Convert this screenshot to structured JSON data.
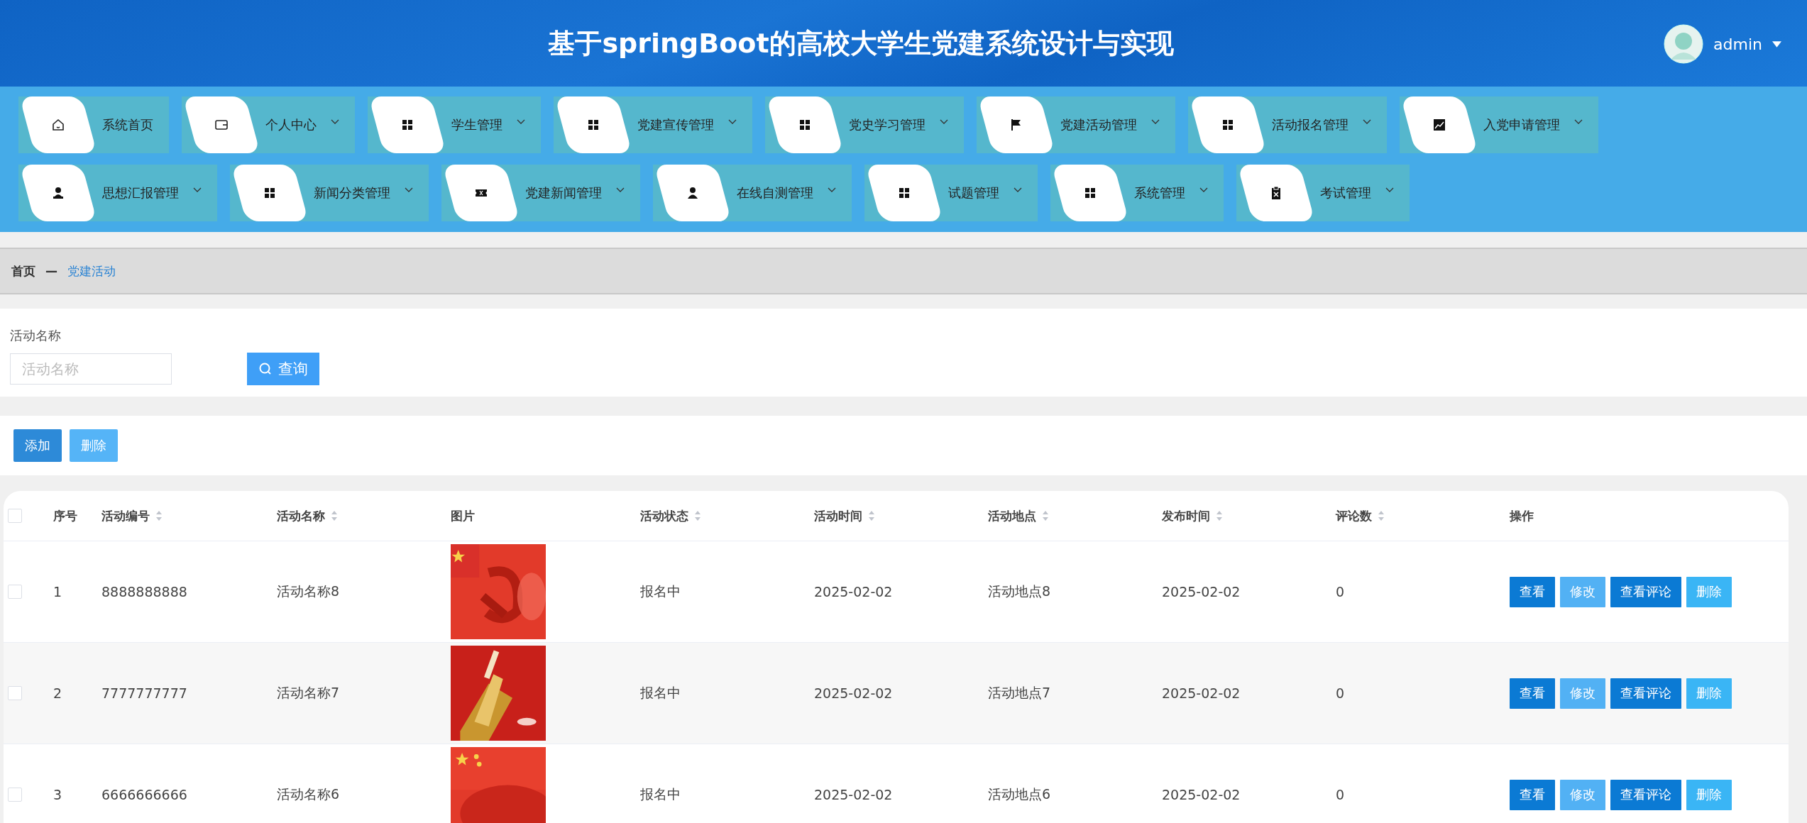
{
  "header": {
    "title": "基于springBoot的高校大学生党建系统设计与实现",
    "user": {
      "name": "admin"
    }
  },
  "nav": [
    {
      "label": "系统首页",
      "has_submenu": false
    },
    {
      "label": "个人中心",
      "has_submenu": true
    },
    {
      "label": "学生管理",
      "has_submenu": true
    },
    {
      "label": "党建宣传管理",
      "has_submenu": true
    },
    {
      "label": "党史学习管理",
      "has_submenu": true
    },
    {
      "label": "党建活动管理",
      "has_submenu": true
    },
    {
      "label": "活动报名管理",
      "has_submenu": true
    },
    {
      "label": "入党申请管理",
      "has_submenu": true
    },
    {
      "label": "思想汇报管理",
      "has_submenu": true
    },
    {
      "label": "新闻分类管理",
      "has_submenu": true
    },
    {
      "label": "党建新闻管理",
      "has_submenu": true
    },
    {
      "label": "在线自测管理",
      "has_submenu": true
    },
    {
      "label": "试题管理",
      "has_submenu": true
    },
    {
      "label": "系统管理",
      "has_submenu": true
    },
    {
      "label": "考试管理",
      "has_submenu": true
    }
  ],
  "breadcrumb": {
    "home": "首页",
    "separator": "—",
    "current": "党建活动"
  },
  "search": {
    "label": "活动名称",
    "placeholder": "活动名称",
    "button": "查询"
  },
  "toolbar": {
    "add": "添加",
    "delete": "删除"
  },
  "table": {
    "select_all_checked": false,
    "columns": [
      {
        "label": "序号",
        "sortable": false
      },
      {
        "label": "活动编号",
        "sortable": true
      },
      {
        "label": "活动名称",
        "sortable": true
      },
      {
        "label": "图片",
        "sortable": false
      },
      {
        "label": "活动状态",
        "sortable": true
      },
      {
        "label": "活动时间",
        "sortable": true
      },
      {
        "label": "活动地点",
        "sortable": true
      },
      {
        "label": "发布时间",
        "sortable": true
      },
      {
        "label": "评论数",
        "sortable": true
      },
      {
        "label": "操作",
        "sortable": false
      }
    ],
    "rows": [
      {
        "checked": false,
        "cells": [
          "1",
          "8888888888",
          "活动名称8",
          null,
          "报名中",
          "2025-02-02",
          "活动地点8",
          "2025-02-02",
          "0"
        ],
        "image": {
          "kind": "picture"
        },
        "actions": [
          "查看",
          "修改",
          "查看评论",
          "删除"
        ]
      },
      {
        "checked": false,
        "cells": [
          "2",
          "7777777777",
          "活动名称7",
          null,
          "报名中",
          "2025-02-02",
          "活动地点7",
          "2025-02-02",
          "0"
        ],
        "image": {
          "kind": "picture"
        },
        "actions": [
          "查看",
          "修改",
          "查看评论",
          "删除"
        ]
      },
      {
        "checked": false,
        "cells": [
          "3",
          "6666666666",
          "活动名称6",
          null,
          "报名中",
          "2025-02-02",
          "活动地点6",
          "2025-02-02",
          "0"
        ],
        "image": {
          "kind": "picture"
        },
        "actions": [
          "查看",
          "修改",
          "查看评论",
          "删除"
        ]
      }
    ]
  }
}
